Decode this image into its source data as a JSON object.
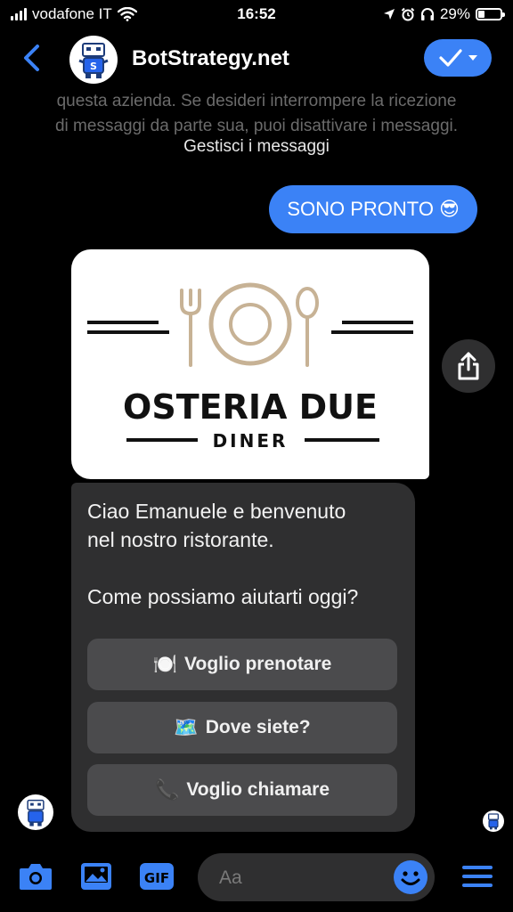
{
  "status": {
    "carrier": "vodafone IT",
    "time": "16:52",
    "battery": "29%",
    "battery_level": 0.29
  },
  "header": {
    "title": "BotStrategy.net",
    "avatar_letter": "S"
  },
  "notice": {
    "line1": "questa azienda. Se desideri interrompere la ricezione",
    "line2": "di messaggi da parte sua, puoi disattivare i messaggi.",
    "link": "Gestisci i messaggi"
  },
  "outgoing": {
    "text": "SONO PRONTO 😎"
  },
  "card": {
    "logo_title": "OSTERIA DUE",
    "logo_subtitle": "DINER",
    "message": "Ciao Emanuele e benvenuto\nnel nostro ristorante.\n\nCome possiamo aiutarti oggi?",
    "quick_replies": [
      {
        "emoji": "🍽️",
        "label": "Voglio prenotare"
      },
      {
        "emoji": "🗺️",
        "label": "Dove siete?"
      },
      {
        "emoji": "📞",
        "label": "Voglio chiamare"
      }
    ]
  },
  "composer": {
    "placeholder": "Aa",
    "gif_label": "GIF"
  },
  "colors": {
    "accent": "#3b82f6",
    "bubble_dark": "#2f2f30",
    "button": "#4b4b4d",
    "logo_gold": "#c7b295"
  }
}
